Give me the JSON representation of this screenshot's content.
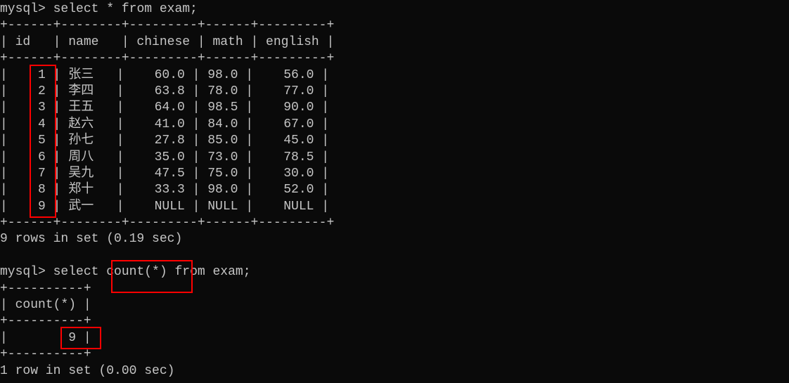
{
  "prompt1": "mysql> ",
  "query1": "select * from exam;",
  "table1": {
    "border_top": "+------+--------+---------+------+---------+",
    "header": "| id   | name   | chinese | math | english |",
    "border_mid": "+------+--------+---------+------+---------+",
    "rows": [
      "|    1 | 张三   |    60.0 | 98.0 |    56.0 |",
      "|    2 | 李四   |    63.8 | 78.0 |    77.0 |",
      "|    3 | 王五   |    64.0 | 98.5 |    90.0 |",
      "|    4 | 赵六   |    41.0 | 84.0 |    67.0 |",
      "|    5 | 孙七   |    27.8 | 85.0 |    45.0 |",
      "|    6 | 周八   |    35.0 | 73.0 |    78.5 |",
      "|    7 | 吴九   |    47.5 | 75.0 |    30.0 |",
      "|    8 | 郑十   |    33.3 | 98.0 |    52.0 |",
      "|    9 | 武一   |    NULL | NULL |    NULL |"
    ],
    "border_bot": "+------+--------+---------+------+---------+"
  },
  "result1": "9 rows in set (0.19 sec)",
  "prompt2": "mysql> ",
  "query2_a": "select ",
  "query2_b": "count(*)",
  "query2_c": " from exam;",
  "table2": {
    "border_top": "+----------+",
    "header": "| count(*) |",
    "border_mid": "+----------+",
    "row": "|        9 |",
    "border_bot": "+----------+"
  },
  "result2": "1 row in set (0.00 sec)"
}
